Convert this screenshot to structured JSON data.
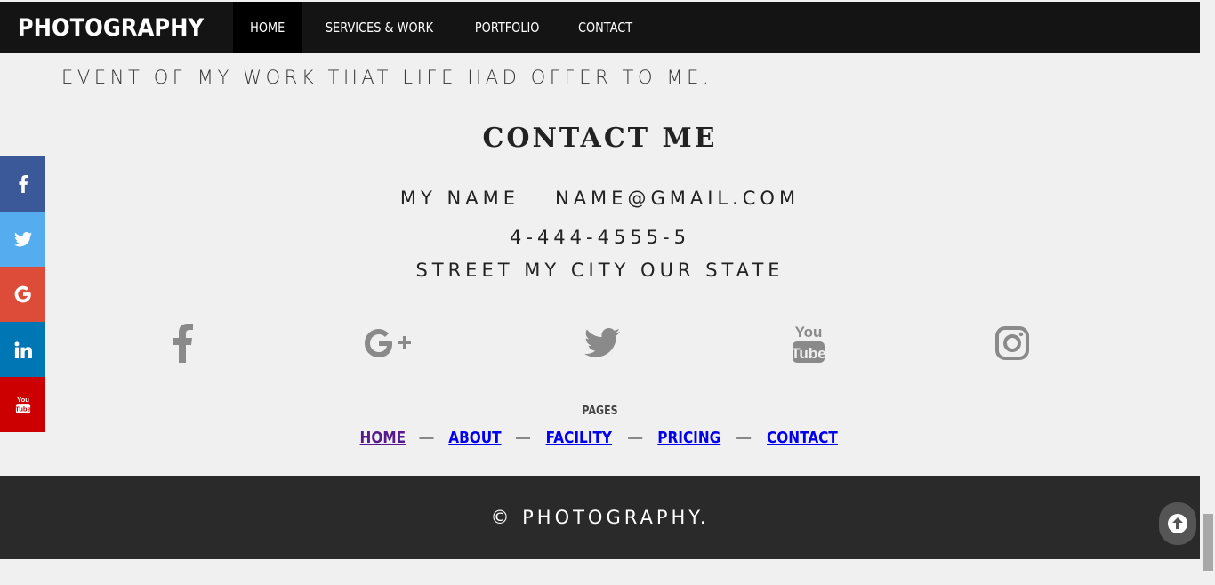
{
  "nav": {
    "brand": "PHOTOGRAPHY",
    "items": [
      {
        "label": "HOME",
        "active": true
      },
      {
        "label": "SERVICES & WORK",
        "active": false
      },
      {
        "label": "PORTFOLIO",
        "active": false
      },
      {
        "label": "CONTACT",
        "active": false
      }
    ]
  },
  "tagline": "EVENT OF MY WORK THAT LIFE HAD OFFER TO ME.",
  "contact": {
    "title": "CONTACT ME",
    "name": "MY NAME",
    "email": "NAME@GMAIL.COM",
    "phone": "4-444-4555-5",
    "address": "STREET MY CITY OUR STATE"
  },
  "social_icons": [
    "facebook-icon",
    "google-plus-icon",
    "twitter-icon",
    "youtube-icon",
    "instagram-icon"
  ],
  "pages": {
    "label": "PAGES",
    "links": [
      "HOME",
      "ABOUT",
      "FACILITY",
      "PRICING",
      "CONTACT"
    ],
    "separator": "—"
  },
  "footer": {
    "copyright": "© PHOTOGRAPHY."
  },
  "side_bar": [
    {
      "icon": "facebook-icon",
      "glyph": "f",
      "color": "#3b5998"
    },
    {
      "icon": "twitter-icon",
      "glyph": "t",
      "color": "#55acee"
    },
    {
      "icon": "google-icon",
      "glyph": "G",
      "color": "#dd4b39"
    },
    {
      "icon": "linkedin-icon",
      "glyph": "in",
      "color": "#0077b5"
    },
    {
      "icon": "youtube-icon",
      "glyph": "yt",
      "color": "#cc0000"
    }
  ],
  "colors": {
    "nav_bg": "#141414",
    "page_bg": "#f0f0f0",
    "footer_bg": "#2a2a2a",
    "icon_gray": "#8a8a8a",
    "link_blue": "#0000ee",
    "link_visited": "#551a8b"
  }
}
